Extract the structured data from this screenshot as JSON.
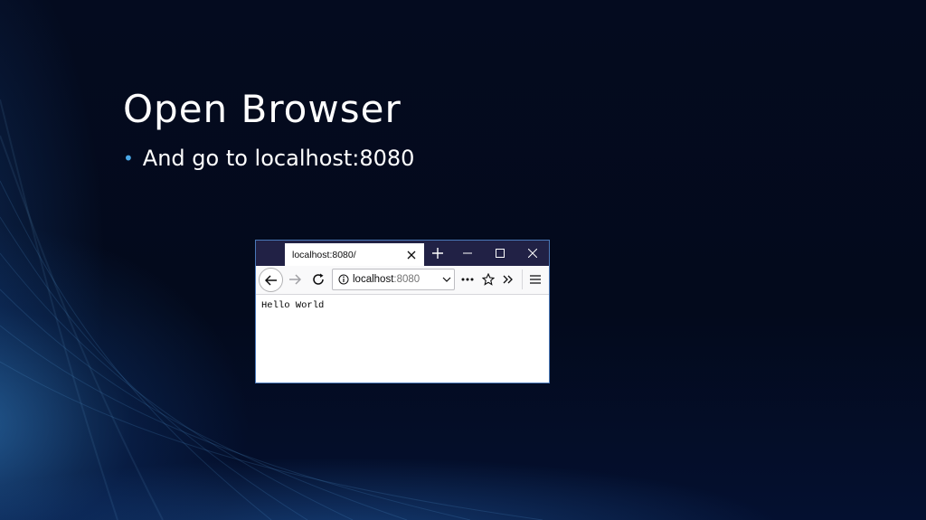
{
  "slide": {
    "title": "Open Browser",
    "bullet": "And go to localhost:8080"
  },
  "browser": {
    "tab_title": "localhost:8080/",
    "url_host": "localhost",
    "url_port": ":8080",
    "page_text": "Hello World"
  },
  "colors": {
    "background": "#03091a",
    "tabbar": "#212145",
    "bullet_accent": "#4aa8e8",
    "window_border": "#4a78b8"
  },
  "icons": [
    "new-tab-icon",
    "minimize-icon",
    "maximize-icon",
    "close-window-icon",
    "tab-close-icon",
    "back-icon",
    "forward-icon",
    "reload-icon",
    "info-icon",
    "dropdown-chevron-icon",
    "page-actions-icon",
    "bookmark-star-icon",
    "overflow-icon",
    "hamburger-menu-icon"
  ]
}
